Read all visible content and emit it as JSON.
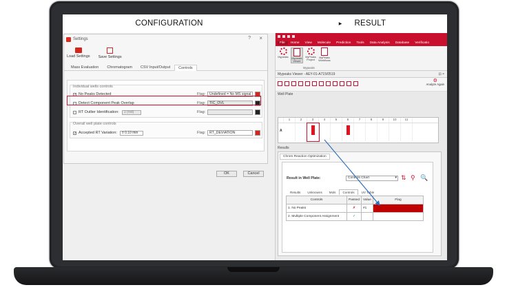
{
  "headers": {
    "configuration": "CONFIGURATION",
    "result": "RESULT"
  },
  "settings_dialog": {
    "title": "Settings",
    "help": "?",
    "close": "×",
    "toolbar": {
      "load": "Load Settings",
      "save": "Save Settings"
    },
    "tabs": [
      "Mass Evaluation",
      "Chromatogram",
      "CSV Input/Output",
      "Controls"
    ],
    "active_tab": "Controls",
    "group_individual": "Individual wells controls",
    "rows": [
      {
        "label": "No Peaks Detected",
        "checked": "✓",
        "flag_label": "Flag:",
        "flag": "Undefined = No MS signal",
        "color": "#d4261c"
      },
      {
        "label": "Detect Component Peak Overlap",
        "checked": "",
        "flag_label": "Flag:",
        "flag": "TIC_OVL",
        "color": "#222222"
      },
      {
        "label": "RT Outlier Identification:",
        "checked": "",
        "spin": "1 (rsd)",
        "flag_label": "Flag:",
        "flag": "",
        "color": "#222222"
      }
    ],
    "group_overall": "Overall well plate controls",
    "overall_rows": [
      {
        "label": "Accepted RT Variation:",
        "checked": "✓",
        "spin": "± 0.10 min",
        "flag_label": "Flag:",
        "flag": "RT_DEVIATION",
        "color": "#d4261c"
      }
    ],
    "ok": "OK",
    "cancel": "Cancel"
  },
  "result_app": {
    "ribbon_tabs": [
      "File",
      "Home",
      "View",
      "Molecule",
      "Prediction",
      "Tools",
      "Data Analysis",
      "Database",
      "Verificatio"
    ],
    "ribbon_buttons": [
      {
        "label": "Mypeaks",
        "selected": false
      },
      {
        "label": "Mypeaks Viewer",
        "selected": true
      },
      {
        "label": "MyPeaks Project",
        "selected": false
      },
      {
        "label": "MyPeaks Workflows",
        "selected": false
      }
    ],
    "ribbon_group": "Mypeaks",
    "viewer_title": "Mypeaks Viewer - AEY-01-A715/0519",
    "viewer_controls": "⊡ ×",
    "analyze": "Analyze\nAgain",
    "well_plate_label": "Well Plate",
    "plate_columns": [
      "1",
      "2",
      "3",
      "4",
      "5",
      "6",
      "7",
      "8",
      "9",
      "10",
      "11"
    ],
    "plate_row_label": "A",
    "red_wells": [
      3,
      6
    ],
    "selected_well": 3,
    "results_label": "Results",
    "option_tab": "Chrom Reaction Optimization",
    "result_in_well_plate": "Result in Well Plate:",
    "combo_value": "Controls Chart",
    "subtabs": [
      "Results",
      "Unknowns",
      "Mols",
      "Controls",
      "UV Table"
    ],
    "active_subtab": "Controls",
    "table_headers": [
      "Controls",
      "Passed",
      "Value",
      "Flag"
    ],
    "table_rows": [
      {
        "control": "1. No Peaks",
        "passed": "✗",
        "value": "#1",
        "flag": "Undefined = No MS signal"
      },
      {
        "control": "2. Multiple Component Assignment",
        "passed": "✓",
        "value": "",
        "flag": ""
      }
    ]
  }
}
